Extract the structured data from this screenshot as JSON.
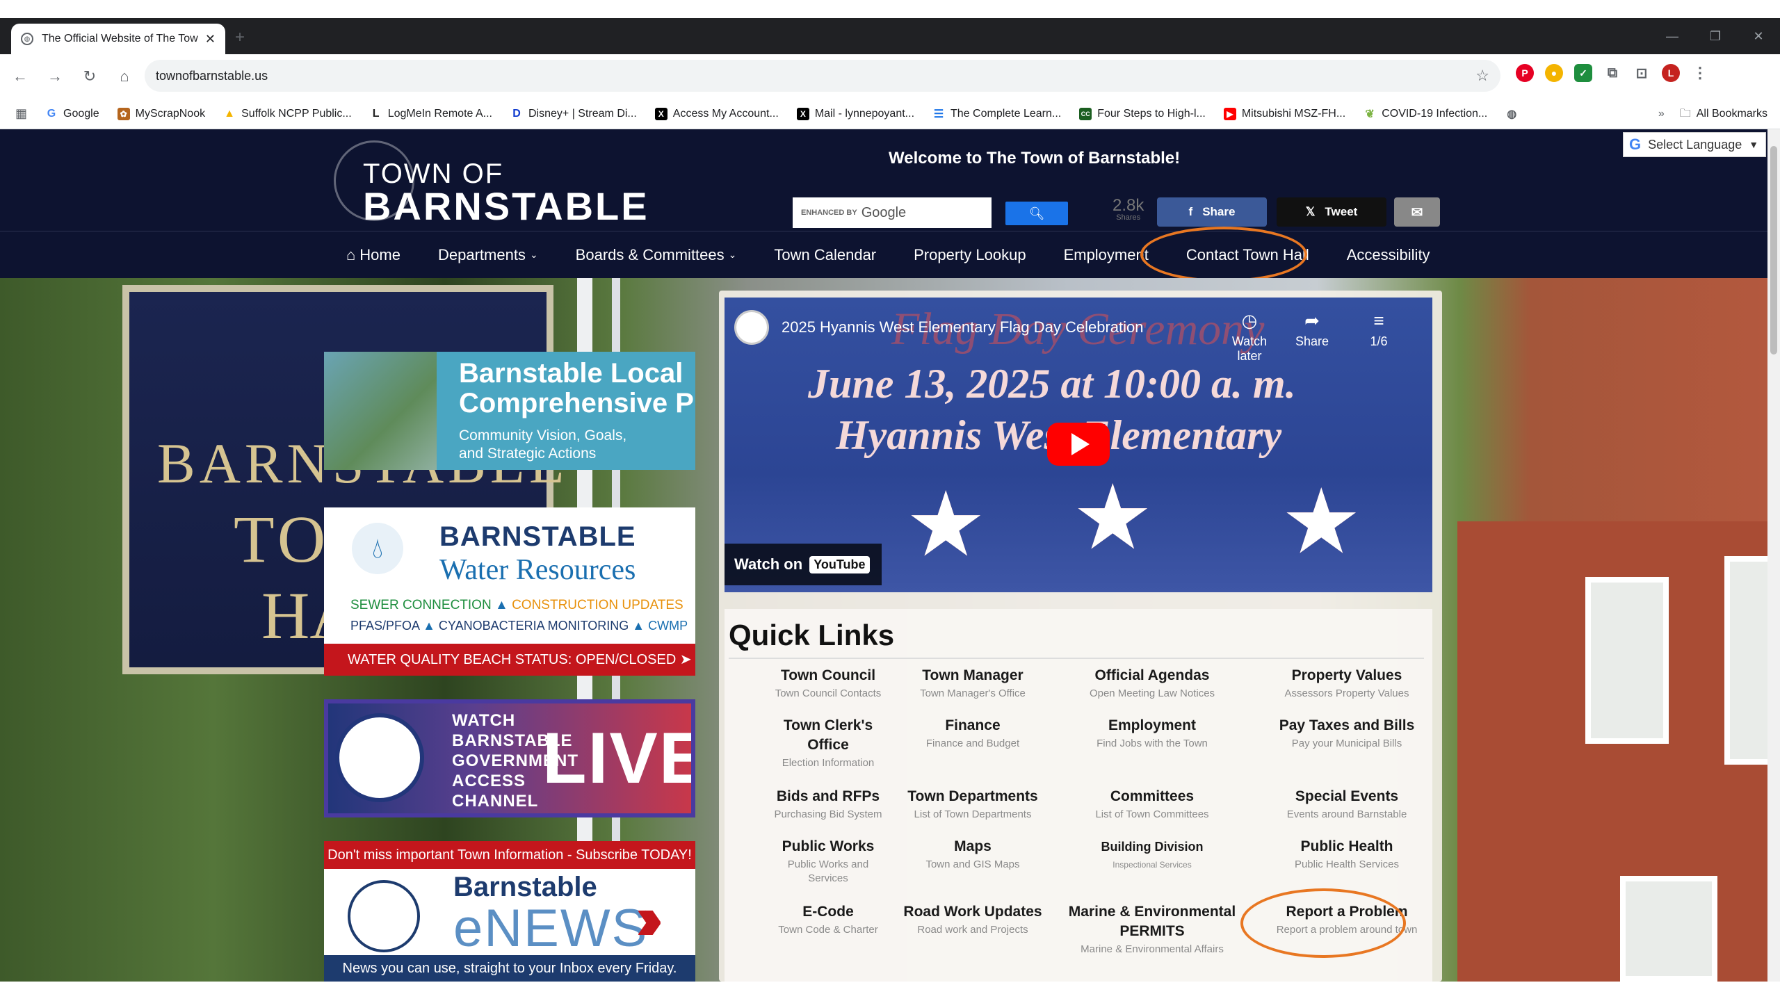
{
  "browser": {
    "tab_title": "The Official Website of The Tow",
    "url": "townofbarnstable.us",
    "bookmarks": [
      {
        "label": "Google",
        "icon": "google-icon",
        "color": "#4285f4"
      },
      {
        "label": "MyScrapNook",
        "icon": "scrapnook-icon",
        "color": "#b5651d"
      },
      {
        "label": "Suffolk NCPP Public...",
        "icon": "drive-icon",
        "color": "#f4b400"
      },
      {
        "label": "LogMeIn Remote A...",
        "icon": "logmein-icon",
        "color": "#222222"
      },
      {
        "label": "Disney+ | Stream Di...",
        "icon": "disney-icon",
        "color": "#113ccf"
      },
      {
        "label": "Access My Account...",
        "icon": "x-icon",
        "color": "#000000"
      },
      {
        "label": "Mail - lynnepoyant...",
        "icon": "x-icon",
        "color": "#000000"
      },
      {
        "label": "The Complete Learn...",
        "icon": "lines-icon",
        "color": "#1a73e8"
      },
      {
        "label": "Four Steps to High-l...",
        "icon": "ccc-icon",
        "color": "#1b5e20"
      },
      {
        "label": "Mitsubishi MSZ-FH...",
        "icon": "youtube-icon",
        "color": "#ff0000"
      },
      {
        "label": "COVID-19 Infection...",
        "icon": "leaf-icon",
        "color": "#7cb342"
      }
    ],
    "all_bookmarks": "All Bookmarks",
    "profile_initial": "L"
  },
  "site": {
    "logo_line1": "TOWN OF",
    "logo_line2": "BARNSTABLE",
    "welcome": "Welcome to The Town of Barnstable!",
    "search": {
      "enhanced": "ENHANCED BY",
      "brand": "Google"
    },
    "shares": {
      "count": "2.8k",
      "label": "Shares"
    },
    "share_fb": "Share",
    "share_tw": "Tweet",
    "translate": "Select Language",
    "nav": [
      {
        "label": "Home"
      },
      {
        "label": "Departments"
      },
      {
        "label": "Boards & Committees"
      },
      {
        "label": "Town Calendar"
      },
      {
        "label": "Property Lookup"
      },
      {
        "label": "Employment"
      },
      {
        "label": "Contact Town Hall"
      },
      {
        "label": "Accessibility"
      }
    ]
  },
  "hero": {
    "sign": [
      "BARNSTABLE",
      "TO",
      "HA"
    ],
    "banner_plan": {
      "title1": "Barnstable Local",
      "title2": "Comprehensive Plan",
      "sub1": "Community Vision, Goals,",
      "sub2": "and Strategic Actions"
    },
    "banner_water": {
      "title1": "BARNSTABLE",
      "title2": "Water Resources",
      "row1a": "SEWER CONNECTION",
      "row1b": "CONSTRUCTION UPDATES",
      "row2a": "PFAS/PFOA",
      "row2b": "CYANOBACTERIA MONITORING",
      "row2c": "CWMP",
      "bar": "WATER QUALITY BEACH STATUS: OPEN/CLOSED"
    },
    "banner_live": {
      "lines": [
        "WATCH",
        "BARNSTABLE",
        "GOVERNMENT",
        "ACCESS",
        "CHANNEL"
      ],
      "live": "LIVE"
    },
    "banner_news": {
      "top": "Don't miss important Town Information - Subscribe TODAY!",
      "brand": "Barnstable",
      "enews": "eNEWS",
      "bottom": "News you can use, straight to your Inbox every Friday."
    }
  },
  "video": {
    "title": "2025 Hyannis West Elementary Flag Day Celebration",
    "ghost": "Flag Day Ceremony",
    "line1": "June 13, 2025 at 10:00 a. m.",
    "line2": "Hyannis West Elementary",
    "watch_later": "Watch later",
    "share": "Share",
    "playlist": "1/6",
    "watch_on": "Watch on",
    "youtube": "YouTube"
  },
  "quick_links": {
    "heading": "Quick Links",
    "items": [
      {
        "title": "Town Council",
        "sub": "Town Council Contacts"
      },
      {
        "title": "Town Manager",
        "sub": "Town Manager's Office"
      },
      {
        "title": "Official Agendas",
        "sub": "Open Meeting Law Notices"
      },
      {
        "title": "Property Values",
        "sub": "Assessors Property Values"
      },
      {
        "title": "Town Clerk's Office",
        "sub": "Election Information"
      },
      {
        "title": "Finance",
        "sub": "Finance and Budget"
      },
      {
        "title": "Employment",
        "sub": "Find Jobs with the Town"
      },
      {
        "title": "Pay Taxes and Bills",
        "sub": "Pay your Municipal Bills"
      },
      {
        "title": "Bids and RFPs",
        "sub": "Purchasing Bid System"
      },
      {
        "title": "Town Departments",
        "sub": "List of Town Departments"
      },
      {
        "title": "Committees",
        "sub": "List of Town Committees"
      },
      {
        "title": "Special Events",
        "sub": "Events around Barnstable"
      },
      {
        "title": "Public Works",
        "sub": "Public Works and Services"
      },
      {
        "title": "Maps",
        "sub": "Town and GIS Maps"
      },
      {
        "title": "Building Division",
        "sub": "Inspectional Services"
      },
      {
        "title": "Public Health",
        "sub": "Public Health Services"
      },
      {
        "title": "E-Code",
        "sub": "Town Code & Charter"
      },
      {
        "title": "Road Work Updates",
        "sub": "Road work and Projects"
      },
      {
        "title": "Marine & Environmental PERMITS",
        "sub": "Marine & Environmental Affairs"
      },
      {
        "title": "Report a Problem",
        "sub": "Report a problem around town"
      }
    ]
  },
  "colors": {
    "header": "#0d1330",
    "highlight": "#e87722",
    "facebook": "#3b5998",
    "alert_red": "#c4161c"
  }
}
